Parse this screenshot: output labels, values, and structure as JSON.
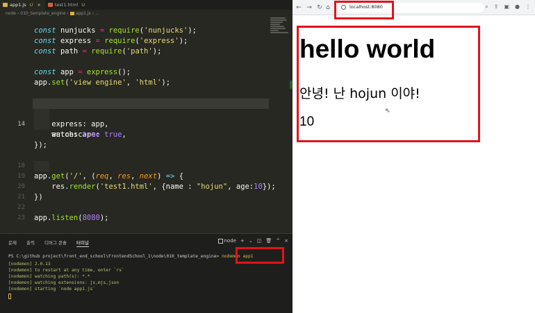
{
  "editor": {
    "tabs": [
      {
        "label": "app1.js",
        "status": "U",
        "icon": "js-file-icon",
        "active": true
      },
      {
        "label": "test1.html",
        "status": "U",
        "icon": "html-file-icon",
        "active": false
      }
    ],
    "breadcrumb": [
      "node",
      "010_template_engine",
      "app1.js",
      "..."
    ],
    "visible_line_numbers": [
      "14",
      "18",
      "19",
      "20",
      "21",
      "22",
      "23"
    ],
    "code_lines": [
      "const nunjucks = require('nunjucks');",
      "const express = require('express');",
      "const path = require('path');",
      "",
      "const app = express();",
      "app.set('view engine', 'html');",
      "",
      "nunjucks.configure('template', {",
      "    autoescape: true,",
      "    express: app,",
      "    watch: true",
      "});",
      "",
      "app.get('/', (req, res, next) => {",
      "    res.render('test1.html', {name : \"hojun\", age:10});",
      "})",
      "",
      "app.listen(8080);"
    ]
  },
  "terminal": {
    "tabs": [
      "문제",
      "출력",
      "디버그 콘솔",
      "터미널"
    ],
    "active_tab": "터미널",
    "shell_label": "node",
    "prompt": "PS C:\\github project\\front_end_school\\FrontendSchool_1\\node\\010_template_engine>",
    "command": "nodemon app1",
    "output": [
      "[nodemon] 2.0.13",
      "[nodemon] to restart at any time, enter `rs`",
      "[nodemon] watching path(s): *.*",
      "[nodemon] watching extensions: js,mjs,json",
      "[nodemon] starting `node app1.js`"
    ]
  },
  "browser": {
    "url": "localhost:8080",
    "heading": "hello world",
    "greeting": "안녕! 난 hojun 이야!",
    "age": "10"
  },
  "colors": {
    "highlight_box": "#e0141b",
    "editor_bg": "#272822",
    "keyword": "#66d9ef",
    "string": "#e6db74",
    "number": "#ae81ff",
    "function": "#a6e22e"
  }
}
